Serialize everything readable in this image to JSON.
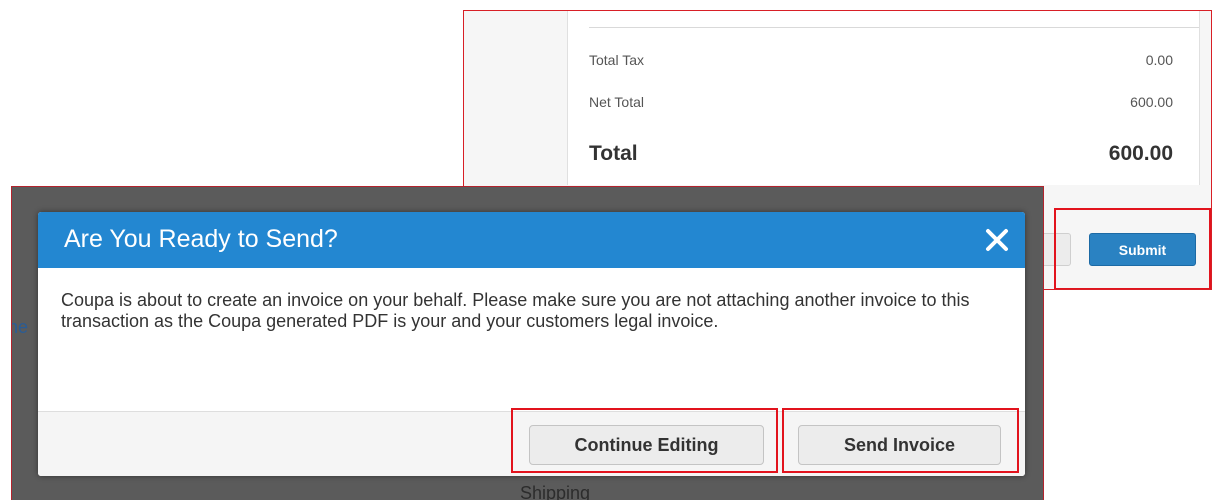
{
  "summary": {
    "rows": [
      {
        "label": "Total Tax",
        "value": "0.00"
      },
      {
        "label": "Net Total",
        "value": "600.00"
      }
    ],
    "total": {
      "label": "Total",
      "value": "600.00"
    }
  },
  "actions": {
    "submit_label": "Submit"
  },
  "backdrop": {
    "left_fragment": "ne",
    "bottom_fragment": "Shipping"
  },
  "dialog": {
    "title": "Are You Ready to Send?",
    "message": "Coupa is about to create an invoice on your behalf. Please make sure you are not attaching another invoice to this transaction as the Coupa generated PDF is your and your customers legal invoice.",
    "continue_label": "Continue Editing",
    "send_label": "Send Invoice",
    "close_icon": "close-icon"
  },
  "colors": {
    "accent_blue": "#2387d1",
    "highlight_red": "#e2131d"
  }
}
